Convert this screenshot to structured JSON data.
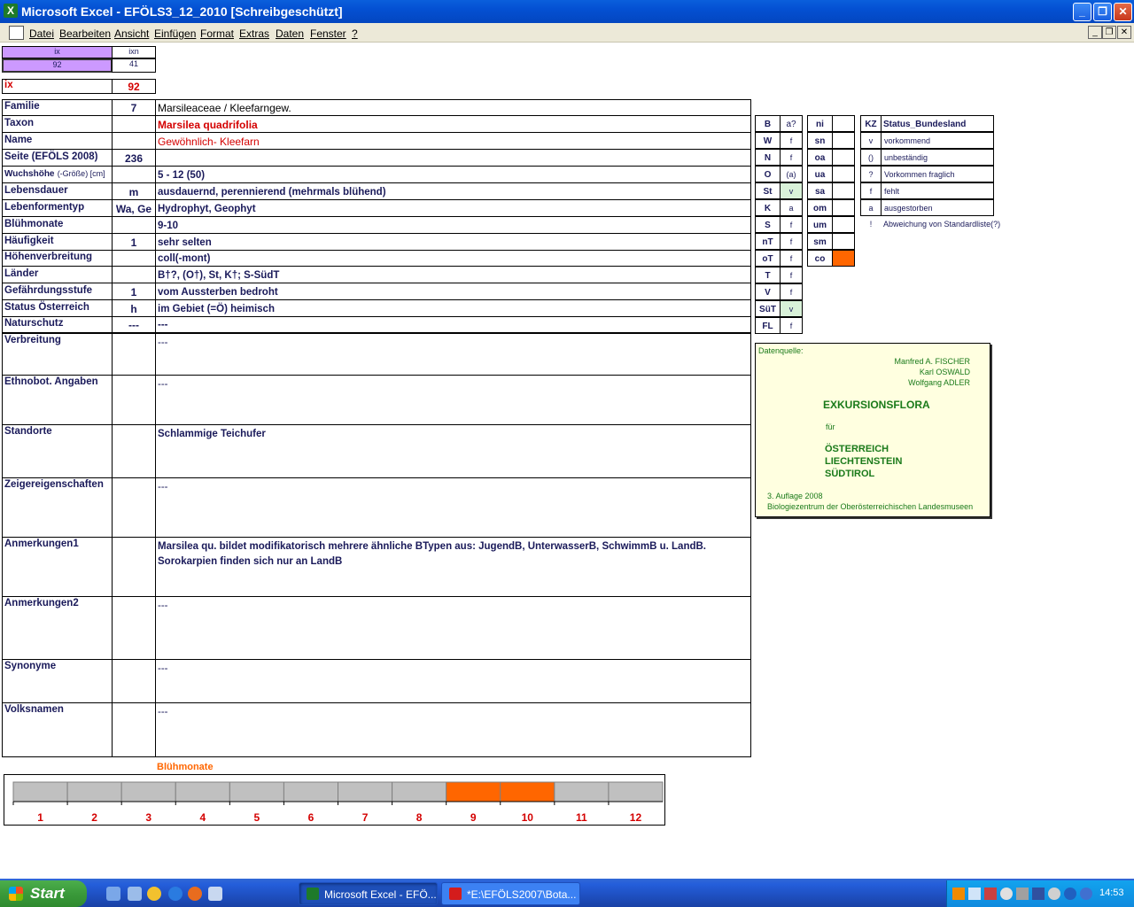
{
  "window": {
    "title": "Microsoft Excel - EFÖLS3_12_2010  [Schreibgeschützt]"
  },
  "menu": [
    "Datei",
    "Bearbeiten",
    "Ansicht",
    "Einfügen",
    "Format",
    "Extras",
    "Daten",
    "Fenster",
    "?"
  ],
  "top": {
    "h1": "ix",
    "h2": "ixn",
    "v1": "92",
    "v2": "41",
    "ix_label": "ix",
    "ix_value": "92"
  },
  "rows": [
    {
      "label": "Familie",
      "code": "7",
      "value": "Marsileaceae  /  Kleefarngew."
    },
    {
      "label": "Taxon",
      "code": "",
      "value": "Marsilea quadrifolia"
    },
    {
      "label": "Name",
      "code": "",
      "value": "Gewöhnlich- Kleefarn"
    },
    {
      "label": "Seite (EFÖLS 2008)",
      "code": "236",
      "value": ""
    },
    {
      "label": "Wuchshöhe",
      "label_suffix": "(-Größe) [cm]",
      "code": "",
      "value": " 5 - 12 (50)"
    },
    {
      "label": "Lebensdauer",
      "code": "m",
      "value": "ausdauernd, perennierend (mehrmals blühend)"
    },
    {
      "label": "Lebenformentyp",
      "code": "Wa, Ge",
      "value": "Hydrophyt, Geophyt"
    },
    {
      "label": "Blühmonate",
      "code": "",
      "value": " 9-10"
    },
    {
      "label": "Häufigkeit",
      "code": "1",
      "value": "sehr selten"
    },
    {
      "label": "Höhenverbreitung",
      "code": "",
      "value": "coll(-mont)"
    },
    {
      "label": "Länder",
      "code": "",
      "value": "B†?, (O†), St, K†; S-SüdT"
    },
    {
      "label": "Gefährdungsstufe",
      "code": "1",
      "value": "vom Aussterben bedroht"
    },
    {
      "label": "Status Österreich",
      "code": "h",
      "value": "im Gebiet (=Ö) heimisch"
    },
    {
      "label": "Naturschutz",
      "code": "---",
      "value": "---"
    }
  ],
  "bigrows": [
    {
      "label": "Verbreitung",
      "value": "---",
      "value2": ""
    },
    {
      "label": "Ethnobot. Angaben",
      "value": "---",
      "value2": ""
    },
    {
      "label": "Standorte",
      "value": "Schlammige Teichufer",
      "value2": ""
    },
    {
      "label": "Zeigereigenschaften",
      "value": "---",
      "value2": ""
    },
    {
      "label": "Anmerkungen1",
      "value": "Marsilea qu. bildet modifikatorisch mehrere ähnliche BTypen aus: JugendB, UnterwasserB, SchwimmB u. LandB.",
      "value2": "Sorokarpien finden sich nur an LandB"
    },
    {
      "label": "Anmerkungen2",
      "value": "---",
      "value2": ""
    },
    {
      "label": "Synonyme",
      "value": "---",
      "value2": ""
    },
    {
      "label": "Volksnamen",
      "value": "---",
      "value2": ""
    }
  ],
  "states": {
    "head": [
      "B",
      "a?"
    ],
    "rows": [
      [
        "W",
        "f"
      ],
      [
        "N",
        "f"
      ],
      [
        "O",
        "(a)"
      ],
      [
        "St",
        "v"
      ],
      [
        "K",
        "a"
      ],
      [
        "S",
        "f"
      ],
      [
        "nT",
        "f"
      ],
      [
        "oT",
        "f"
      ],
      [
        "T",
        "f"
      ],
      [
        "V",
        "f"
      ],
      [
        "SüT",
        "v"
      ],
      [
        "FL",
        "f"
      ]
    ]
  },
  "regions": {
    "head": "ni",
    "rows": [
      "sn",
      "oa",
      "ua",
      "sa",
      "om",
      "um",
      "sm",
      "co"
    ]
  },
  "legend": {
    "head_kz": "KZ",
    "head_status": "Status_Bundesland",
    "rows": [
      [
        "v",
        "vorkommend"
      ],
      [
        "()",
        "unbeständig"
      ],
      [
        "?",
        "Vorkommen fraglich"
      ],
      [
        "f",
        "fehlt"
      ],
      [
        "a",
        "ausgestorben"
      ],
      [
        "!",
        "Abweichung von Standardliste(?)"
      ]
    ]
  },
  "info": {
    "source": "Datenquelle:",
    "authors": [
      "Manfred A. FISCHER",
      "Karl OSWALD",
      "Wolfgang ADLER"
    ],
    "title": "EXKURSIONSFLORA",
    "fuer": "für",
    "countries": [
      "ÖSTERREICH",
      "LIECHTENSTEIN",
      "SÜDTIROL"
    ],
    "edition": "3. Auflage 2008",
    "publisher": "Biologiezentrum der Oberösterreichischen Landesmuseen"
  },
  "chart_data": {
    "type": "bar",
    "title": "Blühmonate",
    "categories": [
      "1",
      "2",
      "3",
      "4",
      "5",
      "6",
      "7",
      "8",
      "9",
      "10",
      "11",
      "12"
    ],
    "values": [
      0,
      0,
      0,
      0,
      0,
      0,
      0,
      0,
      1,
      1,
      0,
      0
    ],
    "colors": {
      "on": "#ff6600",
      "off": "#c0c0c0"
    }
  },
  "taskbar": {
    "start": "Start",
    "tasks": [
      "Microsoft Excel - EFÖ...",
      "*E:\\EFÖLS2007\\Bota..."
    ],
    "clock": "14:53"
  }
}
